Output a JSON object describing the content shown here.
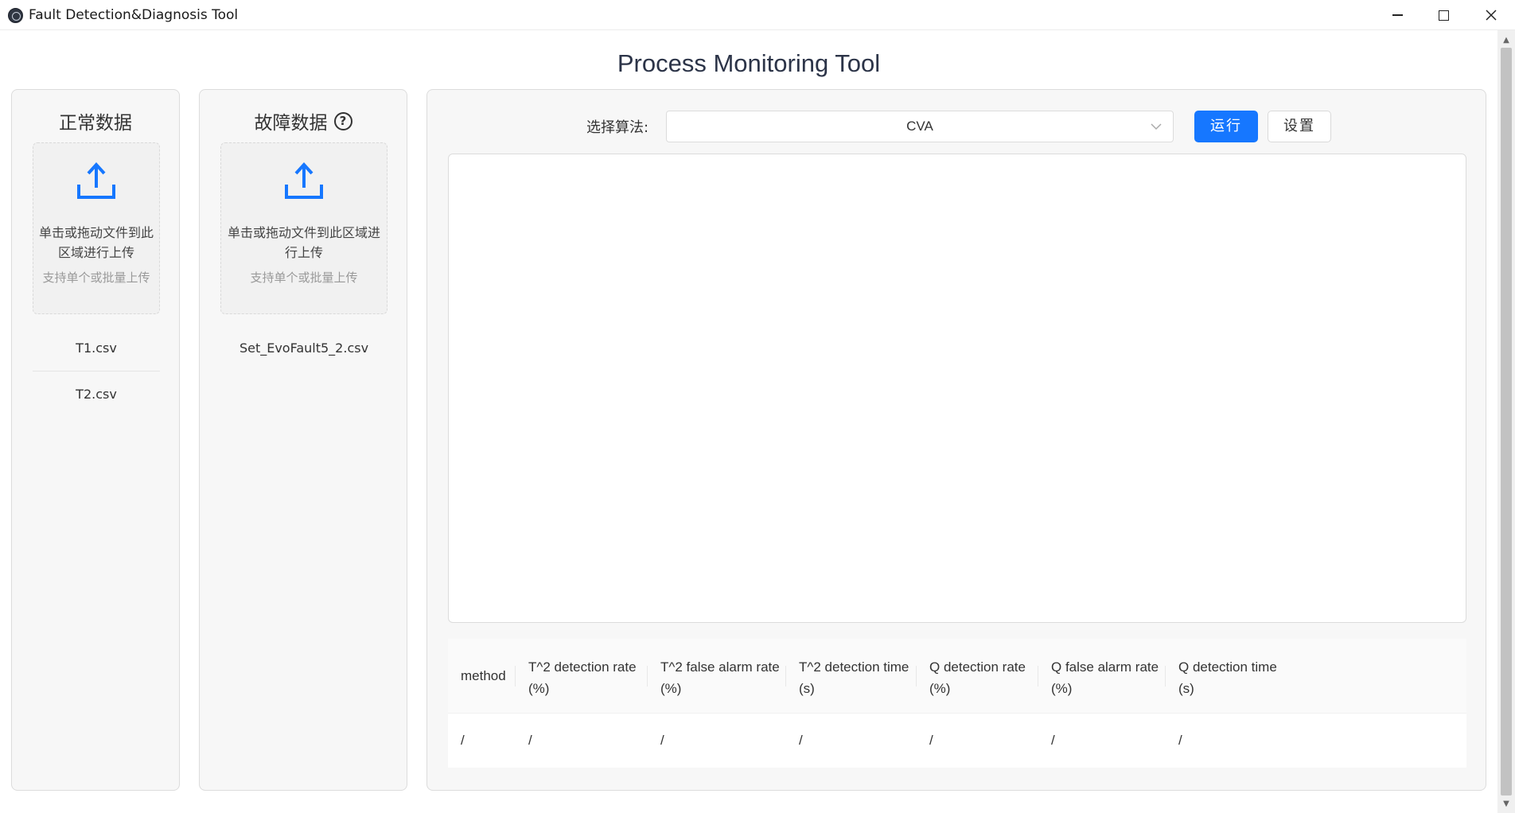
{
  "window": {
    "title": "Fault Detection&Diagnosis Tool",
    "minimize_icon": "minimize-icon",
    "maximize_icon": "maximize-icon",
    "close_icon": "close-icon"
  },
  "page": {
    "title": "Process Monitoring Tool"
  },
  "normal_panel": {
    "heading": "正常数据",
    "dropzone_text": "单击或拖动文件到此区域进行上传",
    "dropzone_hint": "支持单个或批量上传",
    "files": [
      "T1.csv",
      "T2.csv"
    ]
  },
  "fault_panel": {
    "heading": "故障数据",
    "help_icon": "?",
    "dropzone_text": "单击或拖动文件到此区域进行上传",
    "dropzone_hint": "支持单个或批量上传",
    "files": [
      "Set_EvoFault5_2.csv"
    ]
  },
  "toolbar": {
    "algo_label": "选择算法:",
    "algo_value": "CVA",
    "run_label": "运行",
    "settings_label": "设置"
  },
  "colors": {
    "primary": "#1677ff",
    "panel_bg": "#f7f7f7"
  },
  "table": {
    "headers": [
      "method",
      "T^2 detection rate (%)",
      "T^2 false alarm rate (%)",
      "T^2 detection time (s)",
      "Q detection rate (%)",
      "Q false alarm rate (%)",
      "Q detection time (s)"
    ],
    "row": [
      "/",
      "/",
      "/",
      "/",
      "/",
      "/",
      "/"
    ]
  }
}
